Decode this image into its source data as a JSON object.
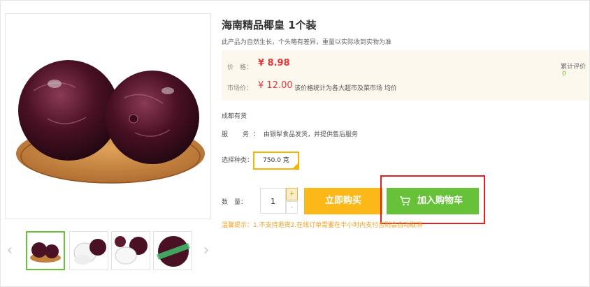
{
  "product": {
    "title": "海南精品椰皇 1个装",
    "subtitle": "此产品为自然生长，个头略有差异，重量以实际收到实物为准"
  },
  "pricing": {
    "price_label": "价　格：",
    "price": "¥ 8.98",
    "market_label": "市场价：",
    "market_price": "¥ 12.00",
    "market_note": "该价格统计为各大超市及菜市场 均价",
    "review_label": "累计评价",
    "review_count": "0"
  },
  "stock_text": "成都有货",
  "service": {
    "label": "服　务：",
    "text": "由银犁食品发货，并提供售后服务"
  },
  "options": {
    "label": "选择种类：",
    "selected": "750.0 克"
  },
  "quantity": {
    "label": "数　量：",
    "value": "1",
    "plus": "+",
    "minus": "-"
  },
  "actions": {
    "buy_label": "立即购买",
    "cart_label": "加入购物车"
  },
  "tip": "温馨提示：1.不支持退货2.在线订单需要在半小时内支付否则会自动取消",
  "gallery": {
    "prev": "‹",
    "next": "›",
    "thumbnail_count": 4,
    "active_index": 0
  },
  "colors": {
    "price_red": "#e4393c",
    "buy_yellow": "#fbb818",
    "cart_green": "#67c23a",
    "highlight_red": "#e02020"
  }
}
